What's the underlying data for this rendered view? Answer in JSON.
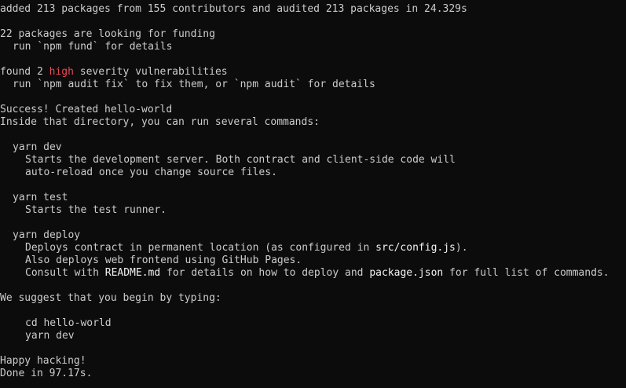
{
  "colors": {
    "background": "#0c0c0c",
    "text": "#cccccc",
    "severity": "#e74856",
    "bold_text": "#f2f2f2"
  },
  "output": {
    "install_summary": "added 213 packages from 155 contributors and audited 213 packages in 24.329s",
    "funding_line": "22 packages are looking for funding",
    "funding_hint": "run `npm fund` for details",
    "vuln_prefix": "found 2 ",
    "vuln_severity": "high",
    "vuln_suffix": " severity vulnerabilities",
    "vuln_hint": "run `npm audit fix` to fix them, or `npm audit` for details",
    "success_line": "Success! Created hello-world",
    "inside_line": "Inside that directory, you can run several commands:",
    "cmd_dev": "yarn dev",
    "cmd_dev_desc_1": "Starts the development server. Both contract and client-side code will",
    "cmd_dev_desc_2": "auto-reload once you change source files.",
    "cmd_test": "yarn test",
    "cmd_test_desc": "Starts the test runner.",
    "cmd_deploy": "yarn deploy",
    "cmd_deploy_desc_1_prefix": "Deploys contract in permanent location (as configured in ",
    "cmd_deploy_desc_1_file": "src/config.js",
    "cmd_deploy_desc_1_suffix": ").",
    "cmd_deploy_desc_2": "Also deploys web frontend using GitHub Pages.",
    "cmd_deploy_desc_3_prefix": "Consult with ",
    "cmd_deploy_desc_3_readme": "README.md",
    "cmd_deploy_desc_3_middle": " for details on how to deploy and ",
    "cmd_deploy_desc_3_pkg": "package.json",
    "cmd_deploy_desc_3_suffix": " for full list of commands.",
    "suggest_line": "We suggest that you begin by typing:",
    "suggest_cmd_1": "cd hello-world",
    "suggest_cmd_2": "yarn dev",
    "happy_line": "Happy hacking!",
    "done_line": "Done in 97.17s."
  }
}
